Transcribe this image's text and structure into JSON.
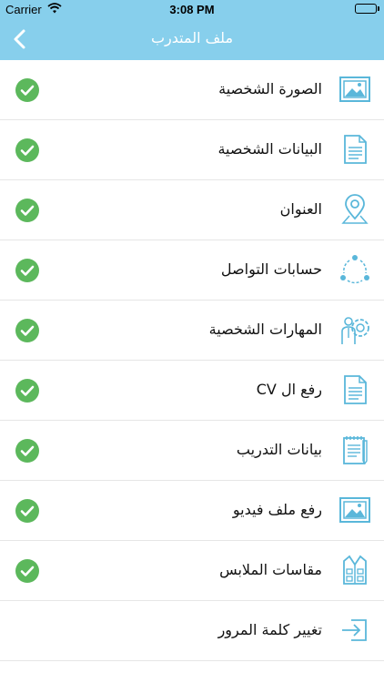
{
  "status_bar": {
    "carrier": "Carrier",
    "time": "3:08 PM"
  },
  "nav": {
    "title": "ملف المتدرب"
  },
  "colors": {
    "bar": "#87cfec",
    "icon": "#5ab7da",
    "check": "#5cb85c"
  },
  "items": [
    {
      "label": "الصورة الشخصية",
      "icon": "image-icon",
      "done": true
    },
    {
      "label": "البيانات الشخصية",
      "icon": "document-icon",
      "done": true
    },
    {
      "label": "العنوان",
      "icon": "location-pin-icon",
      "done": true
    },
    {
      "label": "حسابات التواصل",
      "icon": "share-network-icon",
      "done": true
    },
    {
      "label": "المهارات الشخصية",
      "icon": "person-gear-icon",
      "done": true
    },
    {
      "label": "رفع ال CV",
      "icon": "document-icon",
      "done": true
    },
    {
      "label": "بيانات التدريب",
      "icon": "notepad-icon",
      "done": true
    },
    {
      "label": "رفع ملف فيديو",
      "icon": "image-icon",
      "done": true
    },
    {
      "label": "مقاسات الملابس",
      "icon": "vest-icon",
      "done": true
    },
    {
      "label": "تغيير كلمة المرور",
      "icon": "login-arrow-icon",
      "done": false
    }
  ]
}
